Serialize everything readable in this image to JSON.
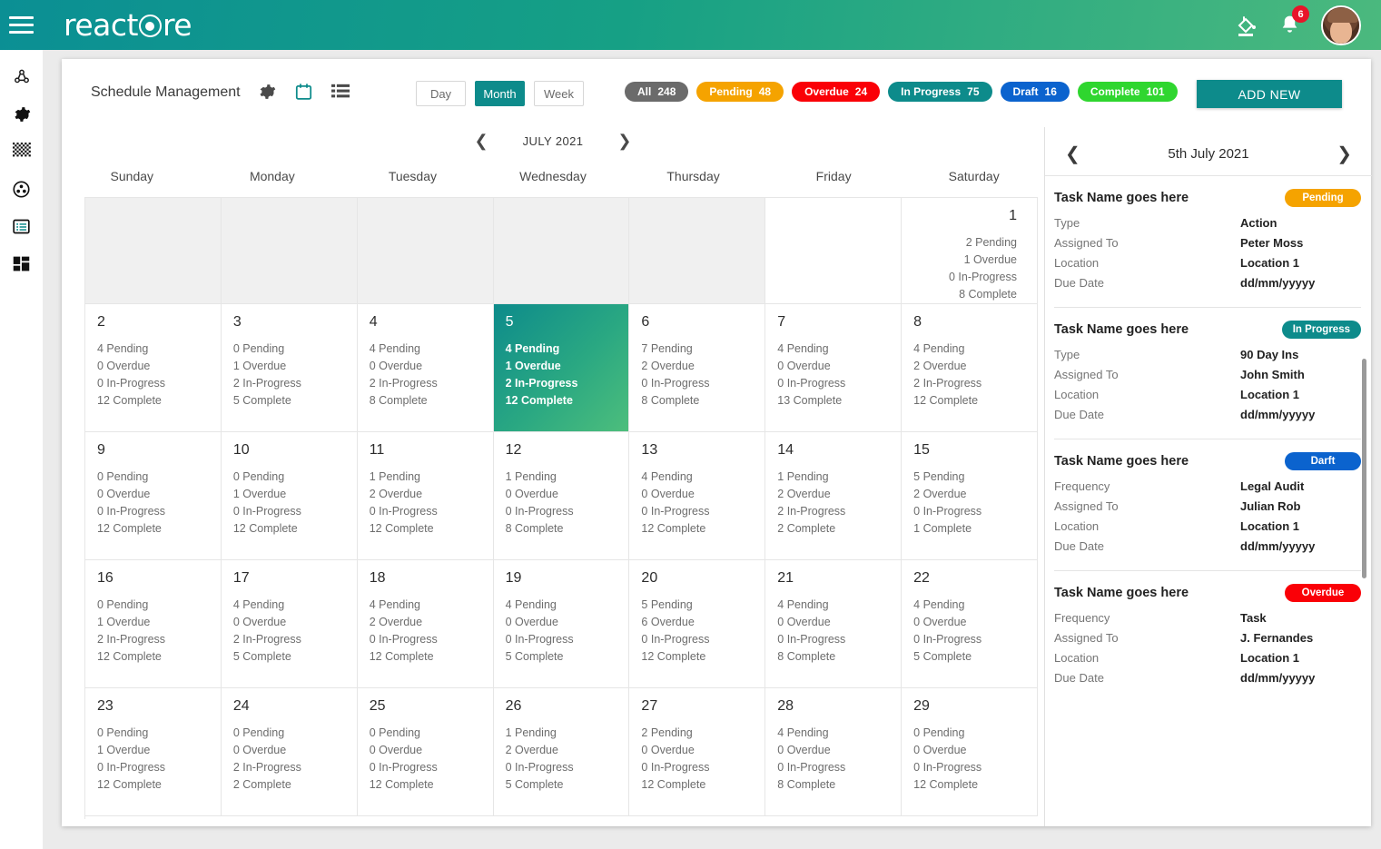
{
  "topbar": {
    "brand_pre": "react",
    "brand_post": "re",
    "menu_icon": "hamburger-icon",
    "theme_icon": "paint-bucket-icon",
    "bell_icon": "bell-icon",
    "notification_count": "6",
    "gradient_from": "#0b8f94",
    "gradient_to": "#4bb97e"
  },
  "rail": {
    "items": [
      {
        "icon": "network-nodes-icon",
        "name": "sidebar-item-network"
      },
      {
        "icon": "gear-icon",
        "name": "sidebar-item-settings"
      },
      {
        "icon": "grid-dots-icon",
        "name": "sidebar-item-grid"
      },
      {
        "icon": "globe-users-icon",
        "name": "sidebar-item-users"
      },
      {
        "icon": "list-panel-icon",
        "name": "sidebar-item-list"
      },
      {
        "icon": "dashboard-blocks-icon",
        "name": "sidebar-item-dashboard"
      }
    ]
  },
  "header": {
    "title": "Schedule Management",
    "icons": [
      {
        "icon": "gear-icon",
        "name": "settings-icon"
      },
      {
        "icon": "calendar-icon",
        "name": "calendar-icon"
      },
      {
        "icon": "list-view-icon",
        "name": "list-view-icon"
      }
    ],
    "views": [
      {
        "label": "Day",
        "active": false
      },
      {
        "label": "Month",
        "active": true
      },
      {
        "label": "Week",
        "active": false
      }
    ],
    "chips": [
      {
        "label": "All",
        "count": "248",
        "color": "#6b6b6b"
      },
      {
        "label": "Pending",
        "count": "48",
        "color": "#f5a300"
      },
      {
        "label": "Overdue",
        "count": "24",
        "color": "#fa0007"
      },
      {
        "label": "In Progress",
        "count": "75",
        "color": "#0d8b8b"
      },
      {
        "label": "Draft",
        "count": "16",
        "color": "#0b63ce"
      },
      {
        "label": "Complete",
        "count": "101",
        "color": "#2fd62f"
      }
    ],
    "add_new_label": "ADD NEW",
    "add_new_color": "#0d8b8b"
  },
  "calendar": {
    "prev_icon": "chevron-left-icon",
    "next_icon": "chevron-right-icon",
    "month_label": "JULY 2021",
    "weekdays": [
      "Sunday",
      "Monday",
      "Tuesday",
      "Wednesday",
      "Thursday",
      "Friday",
      "Saturday"
    ],
    "labels": {
      "pending": "Pending",
      "overdue": "Overdue",
      "in_progress": "In-Progress",
      "complete": "Complete"
    },
    "weeks": [
      [
        {
          "day": "",
          "blank": true
        },
        {
          "day": "",
          "blank": true
        },
        {
          "day": "",
          "blank": true
        },
        {
          "day": "",
          "blank": true
        },
        {
          "day": "",
          "blank": true
        },
        {
          "day": "",
          "blank": false,
          "empty": true
        },
        {
          "day": "1",
          "pending": "2",
          "overdue": "1",
          "in_progress": "0",
          "complete": "8",
          "align": "right"
        }
      ],
      [
        {
          "day": "2",
          "pending": "4",
          "overdue": "0",
          "in_progress": "0",
          "complete": "12"
        },
        {
          "day": "3",
          "pending": "0",
          "overdue": "1",
          "in_progress": "2",
          "complete": "5"
        },
        {
          "day": "4",
          "pending": "4",
          "overdue": "0",
          "in_progress": "2",
          "complete": "8"
        },
        {
          "day": "5",
          "pending": "4",
          "overdue": "1",
          "in_progress": "2",
          "complete": "12",
          "selected": true
        },
        {
          "day": "6",
          "pending": "7",
          "overdue": "2",
          "in_progress": "0",
          "complete": "8"
        },
        {
          "day": "7",
          "pending": "4",
          "overdue": "0",
          "in_progress": "0",
          "complete": "13"
        },
        {
          "day": "8",
          "pending": "4",
          "overdue": "2",
          "in_progress": "2",
          "complete": "12"
        }
      ],
      [
        {
          "day": "9",
          "pending": "0",
          "overdue": "0",
          "in_progress": "0",
          "complete": "12"
        },
        {
          "day": "10",
          "pending": "0",
          "overdue": "1",
          "in_progress": "0",
          "complete": "12"
        },
        {
          "day": "11",
          "pending": "1",
          "overdue": "2",
          "in_progress": "0",
          "complete": "12"
        },
        {
          "day": "12",
          "pending": "1",
          "overdue": "0",
          "in_progress": "0",
          "complete": "8"
        },
        {
          "day": "13",
          "pending": "4",
          "overdue": "0",
          "in_progress": "0",
          "complete": "12"
        },
        {
          "day": "14",
          "pending": "1",
          "overdue": "2",
          "in_progress": "2",
          "complete": "2"
        },
        {
          "day": "15",
          "pending": "5",
          "overdue": "2",
          "in_progress": "0",
          "complete": "1"
        }
      ],
      [
        {
          "day": "16",
          "pending": "0",
          "overdue": "1",
          "in_progress": "2",
          "complete": "12"
        },
        {
          "day": "17",
          "pending": "4",
          "overdue": "0",
          "in_progress": "2",
          "complete": "5"
        },
        {
          "day": "18",
          "pending": "4",
          "overdue": "2",
          "in_progress": "0",
          "complete": "12"
        },
        {
          "day": "19",
          "pending": "4",
          "overdue": "0",
          "in_progress": "0",
          "complete": "5"
        },
        {
          "day": "20",
          "pending": "5",
          "overdue": "6",
          "in_progress": "0",
          "complete": "12"
        },
        {
          "day": "21",
          "pending": "4",
          "overdue": "0",
          "in_progress": "0",
          "complete": "8"
        },
        {
          "day": "22",
          "pending": "4",
          "overdue": "0",
          "in_progress": "0",
          "complete": "5"
        }
      ],
      [
        {
          "day": "23",
          "pending": "0",
          "overdue": "1",
          "in_progress": "0",
          "complete": "12"
        },
        {
          "day": "24",
          "pending": "0",
          "overdue": "0",
          "in_progress": "2",
          "complete": "2"
        },
        {
          "day": "25",
          "pending": "0",
          "overdue": "0",
          "in_progress": "0",
          "complete": "12"
        },
        {
          "day": "26",
          "pending": "1",
          "overdue": "2",
          "in_progress": "0",
          "complete": "5"
        },
        {
          "day": "27",
          "pending": "2",
          "overdue": "0",
          "in_progress": "0",
          "complete": "12"
        },
        {
          "day": "28",
          "pending": "4",
          "overdue": "0",
          "in_progress": "0",
          "complete": "8"
        },
        {
          "day": "29",
          "pending": "0",
          "overdue": "0",
          "in_progress": "0",
          "complete": "12"
        }
      ]
    ]
  },
  "side_panel": {
    "prev_icon": "chevron-left-icon",
    "next_icon": "chevron-right-icon",
    "date_label": "5th July 2021",
    "tasks": [
      {
        "name": "Task Name goes here",
        "badge": "Pending",
        "badge_color": "#f5a300",
        "rows": [
          {
            "key": "Type",
            "value": "Action"
          },
          {
            "key": "Assigned To",
            "value": "Peter Moss"
          },
          {
            "key": "Location",
            "value": "Location 1"
          },
          {
            "key": "Due Date",
            "value": "dd/mm/yyyyy"
          }
        ]
      },
      {
        "name": "Task Name goes here",
        "badge": "In Progress",
        "badge_color": "#0d8b8b",
        "rows": [
          {
            "key": "Type",
            "value": "90 Day Ins"
          },
          {
            "key": "Assigned To",
            "value": "John Smith"
          },
          {
            "key": "Location",
            "value": "Location 1"
          },
          {
            "key": "Due Date",
            "value": "dd/mm/yyyyy"
          }
        ]
      },
      {
        "name": "Task Name goes here",
        "badge": "Darft",
        "badge_color": "#0b63ce",
        "rows": [
          {
            "key": "Frequency",
            "value": "Legal Audit"
          },
          {
            "key": "Assigned To",
            "value": "Julian Rob"
          },
          {
            "key": "Location",
            "value": "Location 1"
          },
          {
            "key": "Due Date",
            "value": "dd/mm/yyyyy"
          }
        ]
      },
      {
        "name": "Task Name goes here",
        "badge": "Overdue",
        "badge_color": "#fa0007",
        "rows": [
          {
            "key": "Frequency",
            "value": "Task"
          },
          {
            "key": "Assigned To",
            "value": "J. Fernandes"
          },
          {
            "key": "Location",
            "value": "Location 1"
          },
          {
            "key": "Due Date",
            "value": "dd/mm/yyyyy"
          }
        ]
      }
    ]
  }
}
